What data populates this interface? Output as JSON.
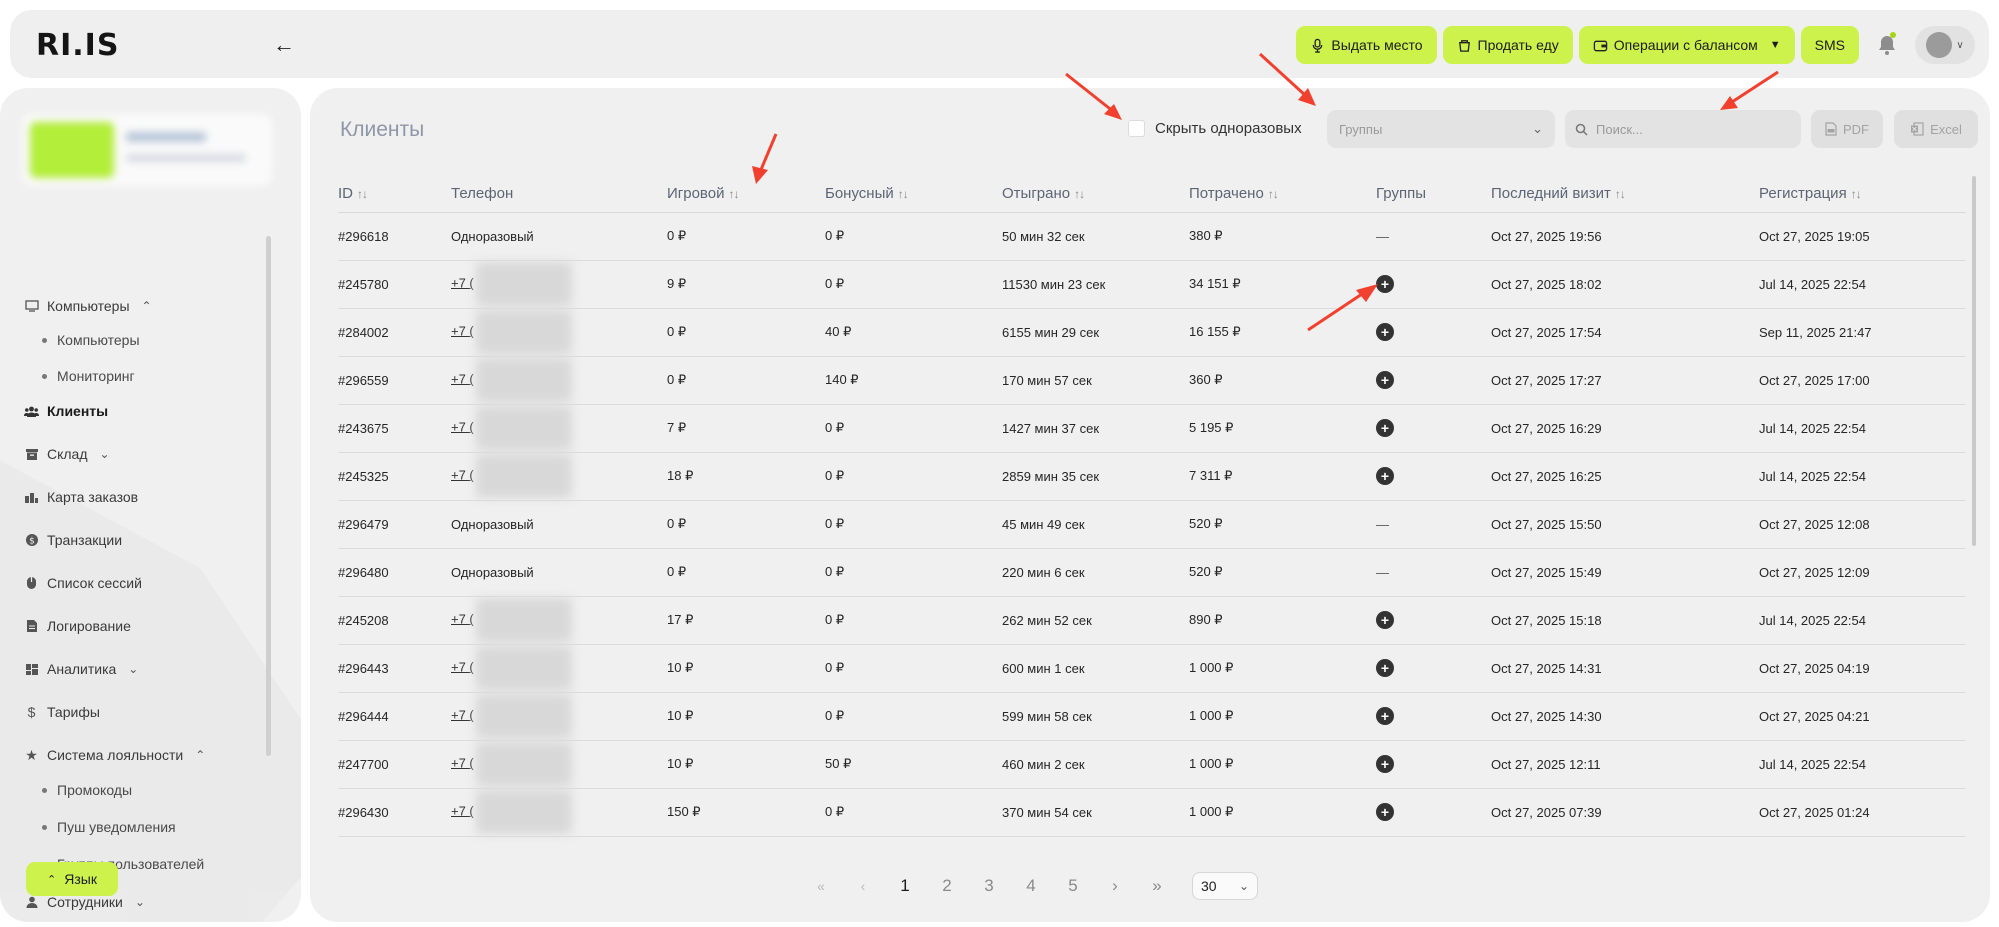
{
  "logo": "RI.IS",
  "topbar": {
    "buttons": {
      "give_place": "Выдать место",
      "sell_food": "Продать еду",
      "balance_ops": "Операции с балансом",
      "sms": "SMS"
    }
  },
  "sidebar": {
    "items": [
      {
        "label": "Компьютеры",
        "icon": "monitor-icon",
        "expanded": true
      },
      {
        "label": "Компьютеры"
      },
      {
        "label": "Мониторинг"
      },
      {
        "label": "Клиенты",
        "icon": "users-icon",
        "active": true
      },
      {
        "label": "Склад",
        "icon": "box-icon"
      },
      {
        "label": "Карта заказов",
        "icon": "orders-icon"
      },
      {
        "label": "Транзакции",
        "icon": "coin-icon"
      },
      {
        "label": "Список сессий",
        "icon": "mouse-icon"
      },
      {
        "label": "Логирование",
        "icon": "file-icon"
      },
      {
        "label": "Аналитика",
        "icon": "dashboard-icon"
      },
      {
        "label": "Тарифы",
        "icon": "dollar-icon"
      },
      {
        "label": "Система лояльности",
        "icon": "star-icon",
        "expanded": true
      },
      {
        "label": "Промокоды"
      },
      {
        "label": "Пуш уведомления"
      },
      {
        "label": "Группы пользователей"
      },
      {
        "label": "Сотрудники",
        "icon": "person-icon"
      }
    ],
    "language": "Язык"
  },
  "main": {
    "title": "Клиенты",
    "hide_once": "Скрыть одноразовых",
    "groups_placeholder": "Группы",
    "search_placeholder": "Поиск...",
    "pdf": "PDF",
    "excel": "Excel"
  },
  "table": {
    "headers": [
      "ID",
      "Телефон",
      "Игровой",
      "Бонусный",
      "Отыграно",
      "Потрачено",
      "Группы",
      "Последний визит",
      "Регистрация"
    ],
    "rows": [
      {
        "id": "#296618",
        "phone": "Одноразовый",
        "game": "0 ₽",
        "bonus": "0 ₽",
        "played": "50 мин 32 сек",
        "spent": "380 ₽",
        "groups": "—",
        "last": "Oct 27, 2025 19:56",
        "reg": "Oct 27, 2025 19:05"
      },
      {
        "id": "#245780",
        "phone": "+7 (",
        "game": "9 ₽",
        "bonus": "0 ₽",
        "played": "11530 мин 23 сек",
        "spent": "34 151 ₽",
        "groups": "+",
        "last": "Oct 27, 2025 18:02",
        "reg": "Jul 14, 2025 22:54"
      },
      {
        "id": "#284002",
        "phone": "+7 (",
        "game": "0 ₽",
        "bonus": "40 ₽",
        "played": "6155 мин 29 сек",
        "spent": "16 155 ₽",
        "groups": "+",
        "last": "Oct 27, 2025 17:54",
        "reg": "Sep 11, 2025 21:47"
      },
      {
        "id": "#296559",
        "phone": "+7 (",
        "game": "0 ₽",
        "bonus": "140 ₽",
        "played": "170 мин 57 сек",
        "spent": "360 ₽",
        "groups": "+",
        "last": "Oct 27, 2025 17:27",
        "reg": "Oct 27, 2025 17:00"
      },
      {
        "id": "#243675",
        "phone": "+7 (",
        "game": "7 ₽",
        "bonus": "0 ₽",
        "played": "1427 мин 37 сек",
        "spent": "5 195 ₽",
        "groups": "+",
        "last": "Oct 27, 2025 16:29",
        "reg": "Jul 14, 2025 22:54"
      },
      {
        "id": "#245325",
        "phone": "+7 (",
        "game": "18 ₽",
        "bonus": "0 ₽",
        "played": "2859 мин 35 сек",
        "spent": "7 311 ₽",
        "groups": "+",
        "last": "Oct 27, 2025 16:25",
        "reg": "Jul 14, 2025 22:54"
      },
      {
        "id": "#296479",
        "phone": "Одноразовый",
        "game": "0 ₽",
        "bonus": "0 ₽",
        "played": "45 мин 49 сек",
        "spent": "520 ₽",
        "groups": "—",
        "last": "Oct 27, 2025 15:50",
        "reg": "Oct 27, 2025 12:08"
      },
      {
        "id": "#296480",
        "phone": "Одноразовый",
        "game": "0 ₽",
        "bonus": "0 ₽",
        "played": "220 мин 6 сек",
        "spent": "520 ₽",
        "groups": "—",
        "last": "Oct 27, 2025 15:49",
        "reg": "Oct 27, 2025 12:09"
      },
      {
        "id": "#245208",
        "phone": "+7 (",
        "game": "17 ₽",
        "bonus": "0 ₽",
        "played": "262 мин 52 сек",
        "spent": "890 ₽",
        "groups": "+",
        "last": "Oct 27, 2025 15:18",
        "reg": "Jul 14, 2025 22:54"
      },
      {
        "id": "#296443",
        "phone": "+7 (",
        "game": "10 ₽",
        "bonus": "0 ₽",
        "played": "600 мин 1 сек",
        "spent": "1 000 ₽",
        "groups": "+",
        "last": "Oct 27, 2025 14:31",
        "reg": "Oct 27, 2025 04:19"
      },
      {
        "id": "#296444",
        "phone": "+7 (",
        "game": "10 ₽",
        "bonus": "0 ₽",
        "played": "599 мин 58 сек",
        "spent": "1 000 ₽",
        "groups": "+",
        "last": "Oct 27, 2025 14:30",
        "reg": "Oct 27, 2025 04:21"
      },
      {
        "id": "#247700",
        "phone": "+7 (",
        "game": "10 ₽",
        "bonus": "50 ₽",
        "played": "460 мин 2 сек",
        "spent": "1 000 ₽",
        "groups": "+",
        "last": "Oct 27, 2025 12:11",
        "reg": "Jul 14, 2025 22:54"
      },
      {
        "id": "#296430",
        "phone": "+7 (",
        "game": "150 ₽",
        "bonus": "0 ₽",
        "played": "370 мин 54 сек",
        "spent": "1 000 ₽",
        "groups": "+",
        "last": "Oct 27, 2025 07:39",
        "reg": "Oct 27, 2025 01:24"
      }
    ]
  },
  "pagination": {
    "first": "«",
    "prev": "‹",
    "pages": [
      "1",
      "2",
      "3",
      "4",
      "5"
    ],
    "next": "›",
    "last": "»",
    "current": "1",
    "per_page": "30"
  },
  "colors": {
    "accent": "#cdf24c",
    "annotation_arrow": "#f2402f"
  }
}
